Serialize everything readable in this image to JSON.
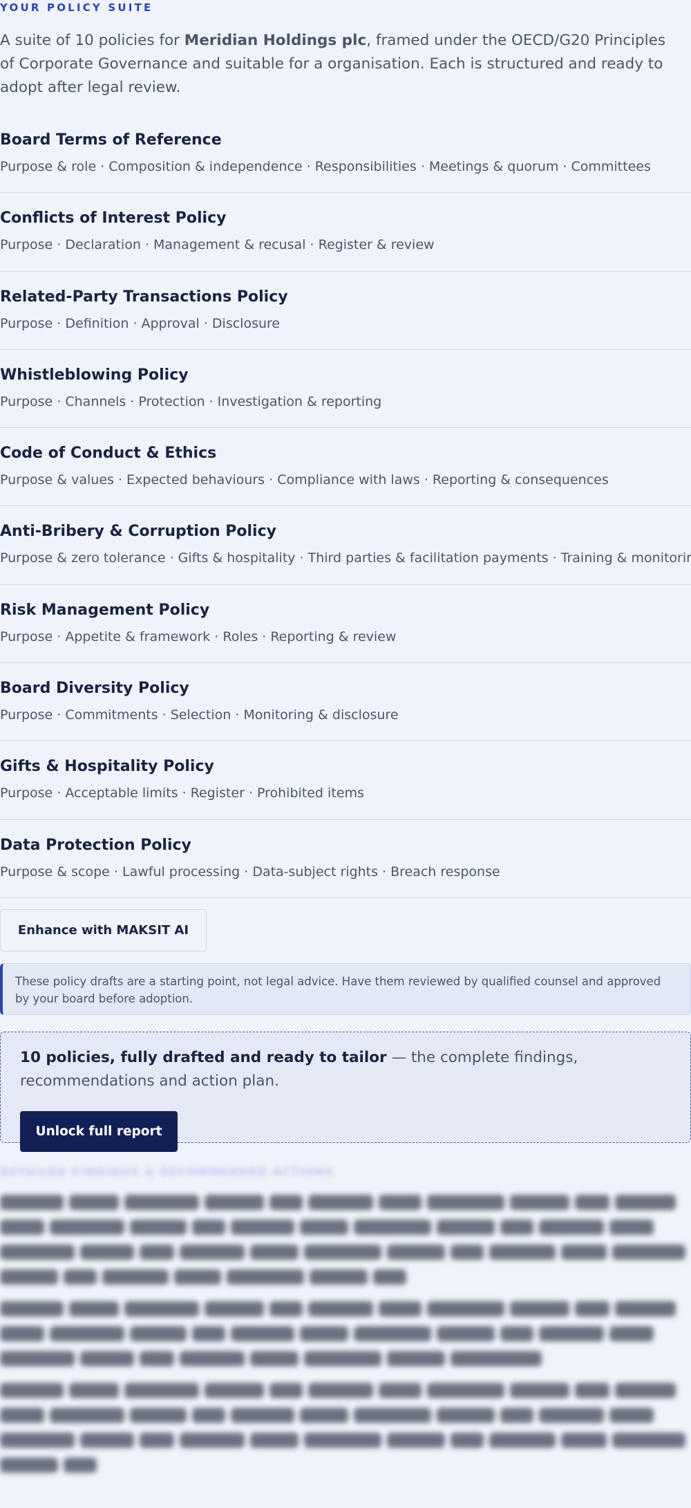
{
  "eyebrow": "YOUR POLICY SUITE",
  "intro": {
    "prefix": "A suite of 10 policies for ",
    "company": "Meridian Holdings plc",
    "suffix": ", framed under the OECD/G20 Principles of Corporate Governance and suitable for a organisation. Each is structured and ready to adopt after legal review."
  },
  "policies": [
    {
      "title": "Board Terms of Reference",
      "sections": "Purpose & role · Composition & independence · Responsibilities · Meetings & quorum · Committees"
    },
    {
      "title": "Conflicts of Interest Policy",
      "sections": "Purpose · Declaration · Management & recusal · Register & review"
    },
    {
      "title": "Related-Party Transactions Policy",
      "sections": "Purpose · Definition · Approval · Disclosure"
    },
    {
      "title": "Whistleblowing Policy",
      "sections": "Purpose · Channels · Protection · Investigation & reporting"
    },
    {
      "title": "Code of Conduct & Ethics",
      "sections": "Purpose & values · Expected behaviours · Compliance with laws · Reporting & consequences"
    },
    {
      "title": "Anti-Bribery & Corruption Policy",
      "sections": "Purpose & zero tolerance · Gifts & hospitality · Third parties & facilitation payments · Training & monitoring"
    },
    {
      "title": "Risk Management Policy",
      "sections": "Purpose · Appetite & framework · Roles · Reporting & review"
    },
    {
      "title": "Board Diversity Policy",
      "sections": "Purpose · Commitments · Selection · Monitoring & disclosure"
    },
    {
      "title": "Gifts & Hospitality Policy",
      "sections": "Purpose · Acceptable limits · Register · Prohibited items"
    },
    {
      "title": "Data Protection Policy",
      "sections": "Purpose & scope · Lawful processing · Data-subject rights · Breach response"
    }
  ],
  "enhance_label": "Enhance with MAKSIT AI",
  "notice": "These policy drafts are a starting point, not legal advice. Have them reviewed by qualified counsel and approved by your board before adoption.",
  "upsell": {
    "bold": "10 policies, fully drafted and ready to tailor",
    "rest": " — the complete findings, recommendations and action plan.",
    "button": "Unlock full report"
  },
  "locked_heading": "DETAILED FINDINGS & RECOMMENDED ACTIONS",
  "colors": {
    "accent": "#2b45a8",
    "button_dark": "#122055",
    "background": "#f0f3fa"
  }
}
